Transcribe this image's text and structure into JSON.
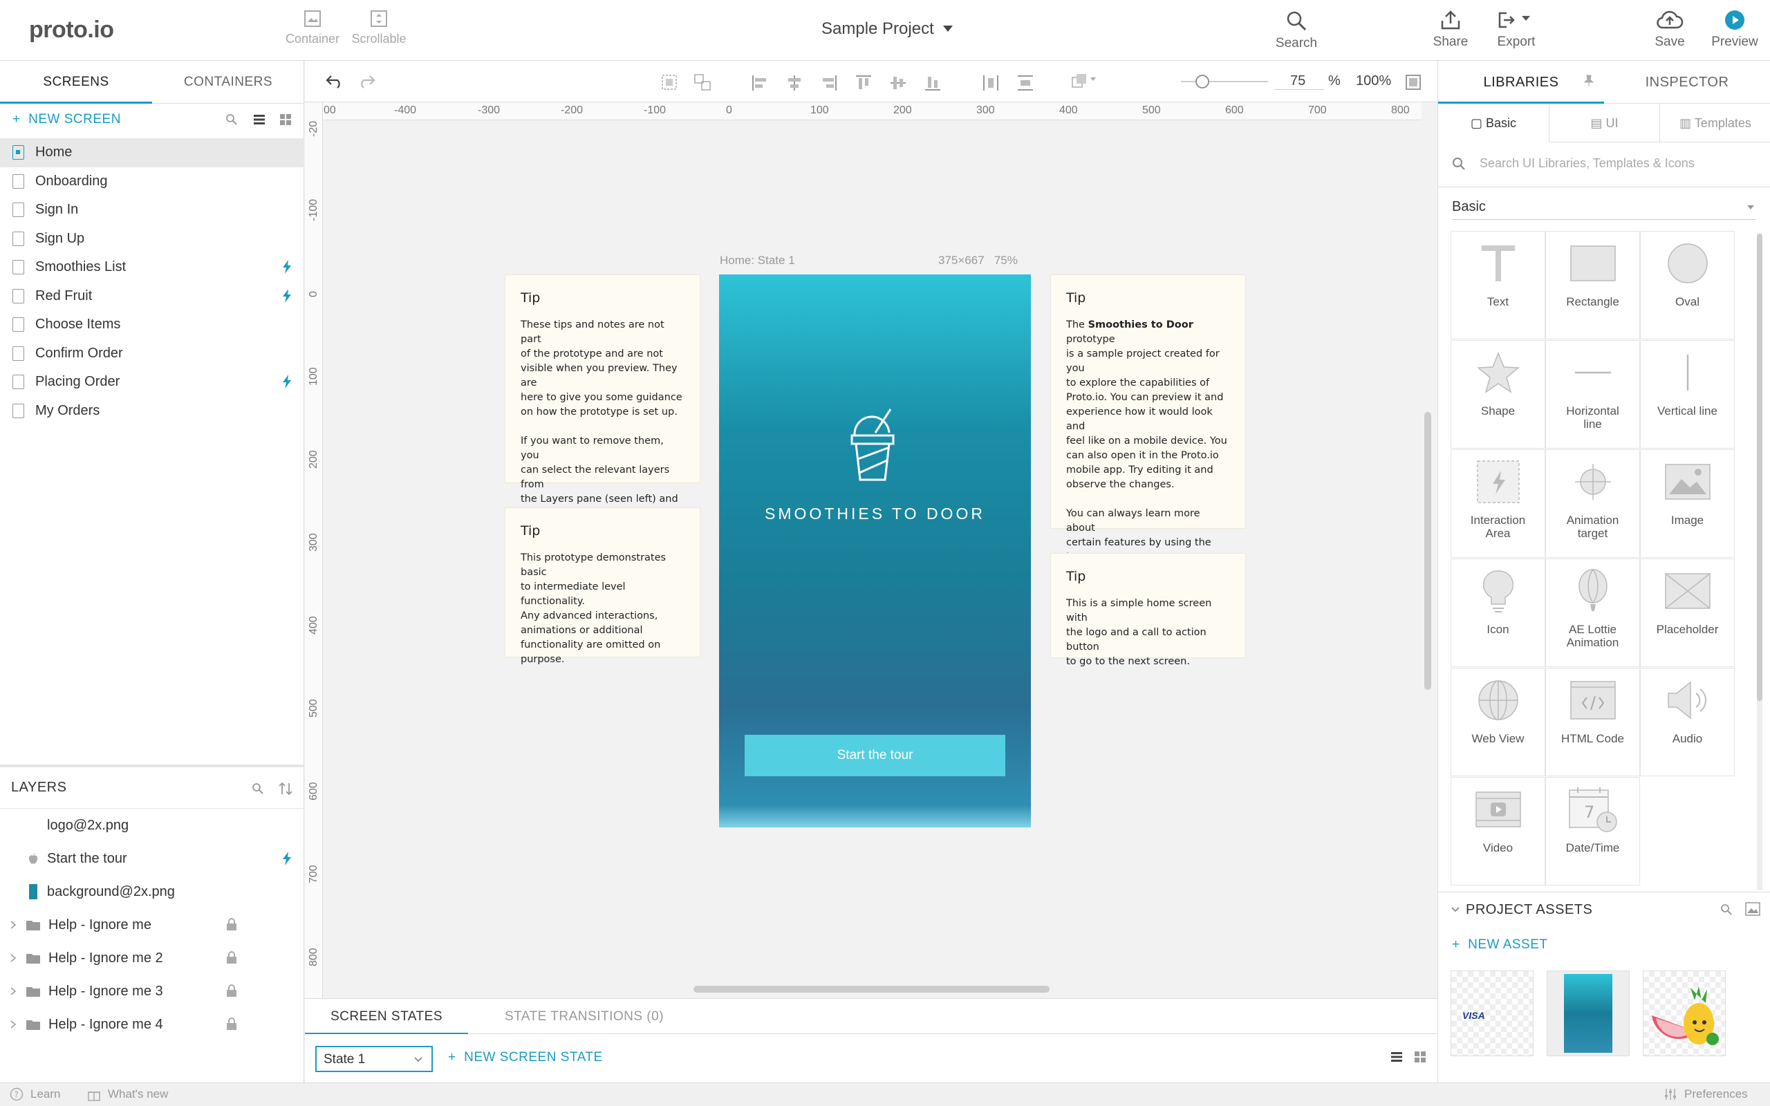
{
  "app": {
    "logo": "proto.io",
    "project_title": "Sample Project"
  },
  "toolbar": {
    "container": "Container",
    "scrollable": "Scrollable",
    "search": "Search",
    "share": "Share",
    "export": "Export",
    "save": "Save",
    "preview": "Preview"
  },
  "left": {
    "tabs": [
      "SCREENS",
      "CONTAINERS"
    ],
    "new_screen": "NEW SCREEN",
    "screens": [
      {
        "name": "Home",
        "active": true,
        "bolt": false
      },
      {
        "name": "Onboarding",
        "bolt": false
      },
      {
        "name": "Sign In",
        "bolt": false
      },
      {
        "name": "Sign Up",
        "bolt": false
      },
      {
        "name": "Smoothies List",
        "bolt": true
      },
      {
        "name": "Red Fruit",
        "bolt": true
      },
      {
        "name": "Choose Items",
        "bolt": false
      },
      {
        "name": "Confirm Order",
        "bolt": false
      },
      {
        "name": "Placing Order",
        "bolt": true
      },
      {
        "name": "My Orders",
        "bolt": false
      }
    ],
    "layers_title": "LAYERS",
    "layers": [
      {
        "name": "logo@2x.png"
      },
      {
        "name": "Start the tour"
      },
      {
        "name": "background@2x.png"
      },
      {
        "name": "Help - Ignore me"
      },
      {
        "name": "Help - Ignore me 2"
      },
      {
        "name": "Help - Ignore me 3"
      },
      {
        "name": "Help - Ignore me 4"
      }
    ]
  },
  "status": {
    "learn": "Learn",
    "whats_new": "What's new",
    "preferences": "Preferences"
  },
  "canvas": {
    "zoom_value": "75",
    "zoom_pct": "%",
    "zoom_fit": "100%",
    "ruler_h": [
      "00",
      "-400",
      "-300",
      "-200",
      "-100",
      "0",
      "100",
      "200",
      "300",
      "400",
      "500",
      "600",
      "700",
      "800"
    ],
    "ruler_v": [
      "-20",
      "-100",
      "0",
      "100",
      "200",
      "300",
      "400",
      "500",
      "600",
      "700",
      "800"
    ],
    "device_label": "Home: State 1",
    "device_dims": "375×667   75%",
    "brand": "SMOOTHIES TO DOOR",
    "start_button": "Start the tour",
    "tips": [
      {
        "title": "Tip",
        "body": "These tips and notes are not part\nof the prototype and are not\nvisible when you preview. They are\nhere to give you some guidance\non how the prototype is set up.\n\nIf you want to remove them, you\ncan select the relevant layers from\nthe Layers pane (seen left) and\ndelete them."
      },
      {
        "title": "Tip",
        "body": "This prototype demonstrates basic\nto intermediate level functionality.\nAny advanced interactions,\nanimations or additional\nfunctionality are omitted on\npurpose."
      },
      {
        "title": "Tip",
        "body_pre": "The ",
        "body_bold": "Smoothies to Door",
        "body_post": " prototype\nis a sample project created for you\nto explore the capabilities of\nProto.io. You can preview it and\nexperience how it would look and\nfeel like on a mobile device. You\ncan also open it in the Proto.io\nmobile app. Try editing it and\nobserve the changes.\n\nYou can always learn more about\ncertain features by using the Learn\noption (bottom left)."
      },
      {
        "title": "Tip",
        "body": "This is a simple home screen with\nthe logo and a call to action button\nto go to the next screen."
      }
    ]
  },
  "bottom": {
    "tabs": [
      "SCREEN STATES",
      "STATE TRANSITIONS (0)"
    ],
    "state": "State 1",
    "new_state": "NEW SCREEN STATE"
  },
  "right": {
    "tabs": [
      "LIBRARIES",
      "INSPECTOR"
    ],
    "subtabs": [
      "Basic",
      "UI",
      "Templates"
    ],
    "search_placeholder": "Search UI Libraries, Templates & Icons",
    "library": "Basic",
    "items": [
      "Text",
      "Rectangle",
      "Oval",
      "Shape",
      "Horizontal line",
      "Vertical line",
      "Interaction Area",
      "Animation target",
      "Image",
      "Icon",
      "AE Lottie Animation",
      "Placeholder",
      "Web View",
      "HTML Code",
      "Audio",
      "Video",
      "Date/Time"
    ],
    "assets_title": "PROJECT ASSETS",
    "new_asset": "NEW ASSET",
    "asset_visa": "VISA"
  },
  "colors": {
    "accent": "#1a9bbf",
    "button": "#52cfe0"
  }
}
